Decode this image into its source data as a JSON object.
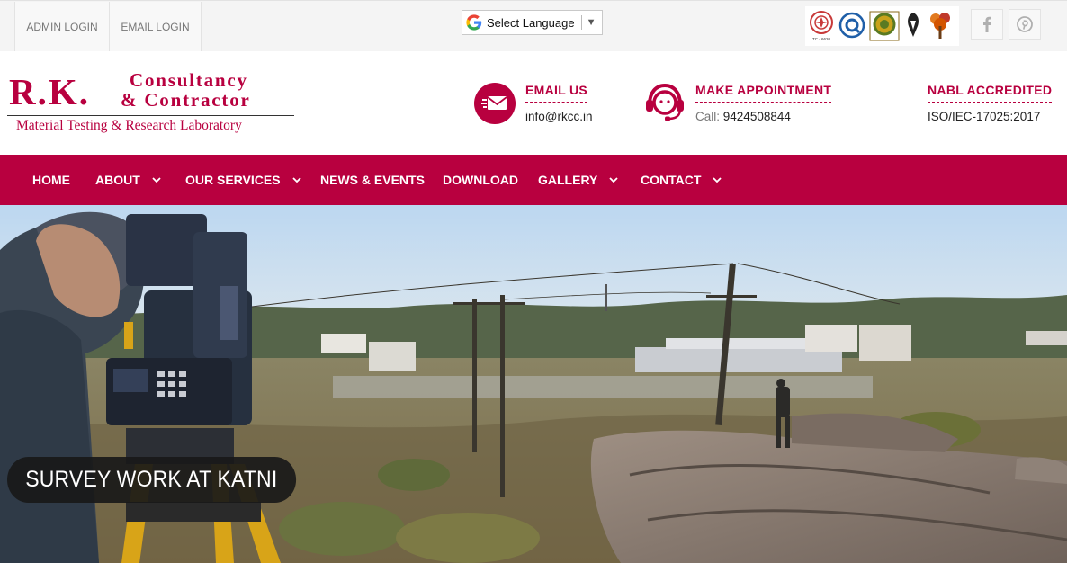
{
  "topbar": {
    "admin_login": "ADMIN LOGIN",
    "email_login": "EMAIL LOGIN",
    "language": {
      "label": "Select Language"
    },
    "logos_tc": "TC - 6620",
    "social": [
      "facebook-icon",
      "pinterest-icon"
    ]
  },
  "brand": {
    "initials": "R.K.",
    "line1": "Consultancy",
    "line2": "& Contractor",
    "tagline": "Material Testing & Research Laboratory",
    "color": "#b8003f"
  },
  "header": {
    "email": {
      "title": "EMAIL US",
      "value": "info@rkcc.in"
    },
    "appointment": {
      "title": "MAKE APPOINTMENT",
      "label": "Call:",
      "phone": "9424508844"
    },
    "accreditation": {
      "title": "NABL ACCREDITED",
      "standard": "ISO/IEC-17025:2017"
    }
  },
  "nav": {
    "items": [
      {
        "label": "HOME"
      },
      {
        "label": "ABOUT"
      },
      {
        "label": "OUR SERVICES"
      },
      {
        "label": "NEWS & EVENTS"
      },
      {
        "label": "DOWNLOAD"
      },
      {
        "label": "GALLERY"
      },
      {
        "label": "CONTACT"
      }
    ]
  },
  "hero": {
    "caption": "SURVEY WORK AT KATNI"
  }
}
